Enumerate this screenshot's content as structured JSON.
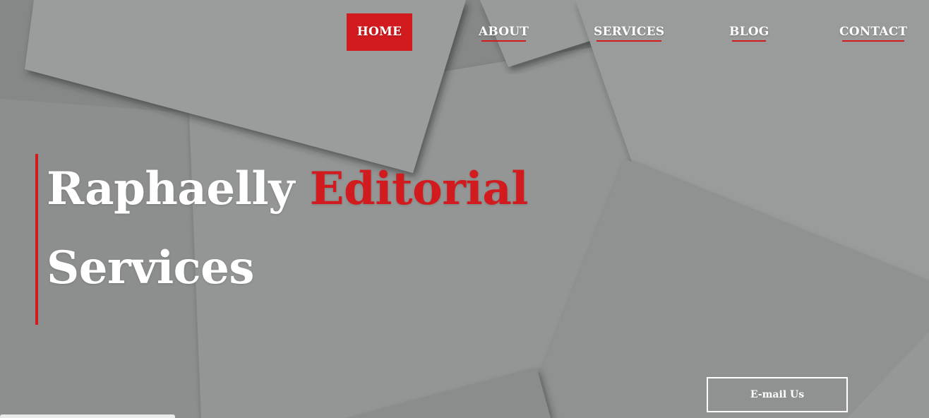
{
  "nav": {
    "items": [
      {
        "label": "HOME",
        "active": true
      },
      {
        "label": "ABOUT",
        "active": false
      },
      {
        "label": "SERVICES",
        "active": false
      },
      {
        "label": "BLOG",
        "active": false
      },
      {
        "label": "CONTACT",
        "active": false
      }
    ]
  },
  "hero": {
    "title_part1": "Raphaelly",
    "title_accent": "Editorial",
    "title_part2": "Services",
    "cta_label": "E-mail Us"
  },
  "colors": {
    "accent": "#d21b1f",
    "text": "#ffffff",
    "background": "#8f9290"
  }
}
